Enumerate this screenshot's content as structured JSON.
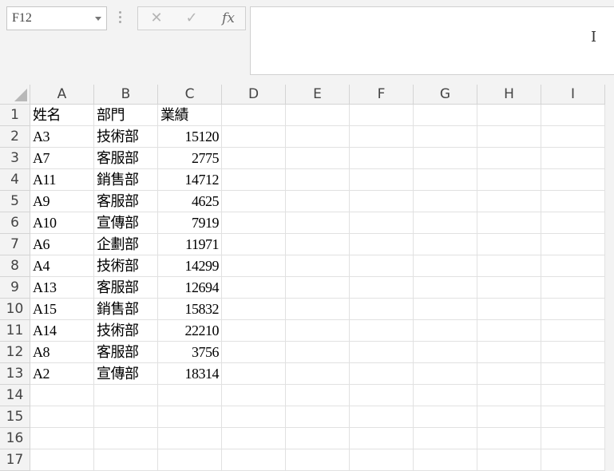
{
  "formula_bar": {
    "name_box": "F12",
    "cancel_symbol": "✕",
    "enter_symbol": "✓",
    "fx_symbol": "fx",
    "formula_value": ""
  },
  "columns": [
    "A",
    "B",
    "C",
    "D",
    "E",
    "F",
    "G",
    "H",
    "I"
  ],
  "row_numbers": [
    "1",
    "2",
    "3",
    "4",
    "5",
    "6",
    "7",
    "8",
    "9",
    "10",
    "11",
    "12",
    "13",
    "14",
    "15",
    "16",
    "17"
  ],
  "rows": [
    [
      "姓名",
      "部門",
      "業績"
    ],
    [
      "A3",
      "技術部",
      "15120"
    ],
    [
      "A7",
      "客服部",
      "2775"
    ],
    [
      "A11",
      "銷售部",
      "14712"
    ],
    [
      "A9",
      "客服部",
      "4625"
    ],
    [
      "A10",
      "宣傳部",
      "7919"
    ],
    [
      "A6",
      "企劃部",
      "11971"
    ],
    [
      "A4",
      "技術部",
      "14299"
    ],
    [
      "A13",
      "客服部",
      "12694"
    ],
    [
      "A15",
      "銷售部",
      "15832"
    ],
    [
      "A14",
      "技術部",
      "22210"
    ],
    [
      "A8",
      "客服部",
      "3756"
    ],
    [
      "A2",
      "宣傳部",
      "18314"
    ],
    [
      "",
      "",
      ""
    ],
    [
      "",
      "",
      ""
    ],
    [
      "",
      "",
      ""
    ],
    [
      "",
      "",
      ""
    ]
  ]
}
